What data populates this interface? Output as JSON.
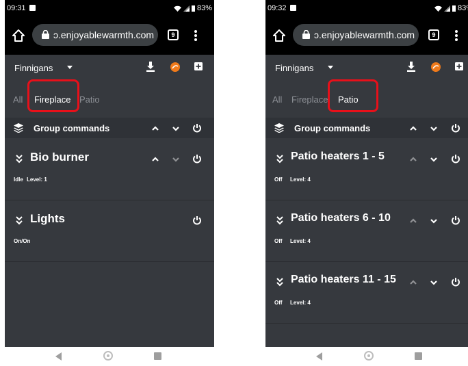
{
  "left": {
    "status": {
      "time": "09:31",
      "battery": "83%"
    },
    "browser": {
      "url": "ɔ.enjoyablewarmth.com",
      "tab_count": "9"
    },
    "app": {
      "site": "Finnigans",
      "tabs": [
        "All",
        "Fireplace",
        "Patio"
      ],
      "active_tab": "Fireplace",
      "group_label": "Group commands",
      "devices": [
        {
          "name": "Bio burner",
          "state": "Idle",
          "level": "Level: 1"
        },
        {
          "name": "Lights",
          "state": "On/On",
          "level": ""
        }
      ]
    }
  },
  "right": {
    "status": {
      "time": "09:32",
      "battery": "83%"
    },
    "browser": {
      "url": "ɔ.enjoyablewarmth.com",
      "tab_count": "9"
    },
    "app": {
      "site": "Finnigans",
      "tabs": [
        "All",
        "Fireplace",
        "Patio"
      ],
      "active_tab": "Patio",
      "group_label": "Group commands",
      "devices": [
        {
          "name": "Patio heaters 1 - 5",
          "state": "Off",
          "level": "Level: 4"
        },
        {
          "name": "Patio heaters 6 - 10",
          "state": "Off",
          "level": "Level: 4"
        },
        {
          "name": "Patio heaters 11 - 15",
          "state": "Off",
          "level": "Level: 4"
        }
      ]
    }
  },
  "colors": {
    "app_bg": "#36393e",
    "group_bg": "#2f3237",
    "inactive_text": "#8c8f95",
    "highlight": "#e8101a",
    "brand_orange": "#f07a1a",
    "url_pill": "#3c4043"
  },
  "icons": {
    "home": "home-icon",
    "lock": "lock-icon",
    "menu": "more-vert-icon",
    "download": "download-icon",
    "brand": "brand-logo-icon",
    "add": "add-box-icon",
    "group": "layers-icon",
    "up": "chevron-up-icon",
    "down": "chevron-down-icon",
    "power": "power-icon",
    "expand": "double-chevron-down-icon"
  }
}
